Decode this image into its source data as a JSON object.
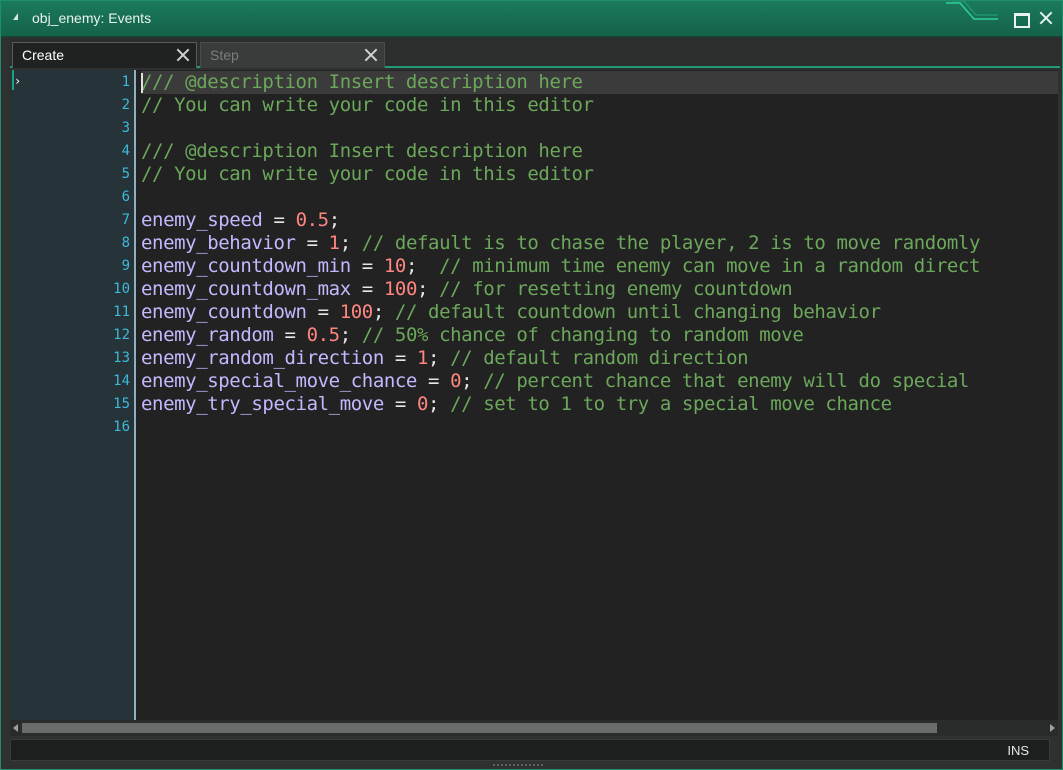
{
  "window": {
    "title": "obj_enemy: Events",
    "accent_color": "#1d8f6d"
  },
  "tabs": [
    {
      "label": "Create",
      "active": true
    },
    {
      "label": "Step",
      "active": false
    }
  ],
  "editor": {
    "current_line": 1,
    "line_numbers": [
      "1",
      "2",
      "3",
      "4",
      "5",
      "6",
      "7",
      "8",
      "9",
      "10",
      "11",
      "12",
      "13",
      "14",
      "15",
      "16"
    ],
    "lines": [
      [
        {
          "t": "comment",
          "v": "/// @description Insert description here"
        }
      ],
      [
        {
          "t": "comment",
          "v": "// You can write your code in this editor"
        }
      ],
      [],
      [
        {
          "t": "comment",
          "v": "/// @description Insert description here"
        }
      ],
      [
        {
          "t": "comment",
          "v": "// You can write your code in this editor"
        }
      ],
      [],
      [
        {
          "t": "var",
          "v": "enemy_speed"
        },
        {
          "t": "op",
          "v": " = "
        },
        {
          "t": "num",
          "v": "0.5"
        },
        {
          "t": "op",
          "v": ";"
        }
      ],
      [
        {
          "t": "var",
          "v": "enemy_behavior"
        },
        {
          "t": "op",
          "v": " = "
        },
        {
          "t": "num",
          "v": "1"
        },
        {
          "t": "op",
          "v": "; "
        },
        {
          "t": "comment",
          "v": "// default is to chase the player, 2 is to move randomly"
        }
      ],
      [
        {
          "t": "var",
          "v": "enemy_countdown_min"
        },
        {
          "t": "op",
          "v": " = "
        },
        {
          "t": "num",
          "v": "10"
        },
        {
          "t": "op",
          "v": ";  "
        },
        {
          "t": "comment",
          "v": "// minimum time enemy can move in a random direct"
        }
      ],
      [
        {
          "t": "var",
          "v": "enemy_countdown_max"
        },
        {
          "t": "op",
          "v": " = "
        },
        {
          "t": "num",
          "v": "100"
        },
        {
          "t": "op",
          "v": "; "
        },
        {
          "t": "comment",
          "v": "// for resetting enemy countdown"
        }
      ],
      [
        {
          "t": "var",
          "v": "enemy_countdown"
        },
        {
          "t": "op",
          "v": " = "
        },
        {
          "t": "num",
          "v": "100"
        },
        {
          "t": "op",
          "v": "; "
        },
        {
          "t": "comment",
          "v": "// default countdown until changing behavior"
        }
      ],
      [
        {
          "t": "var",
          "v": "enemy_random"
        },
        {
          "t": "op",
          "v": " = "
        },
        {
          "t": "num",
          "v": "0.5"
        },
        {
          "t": "op",
          "v": "; "
        },
        {
          "t": "comment",
          "v": "// 50% chance of changing to random move"
        }
      ],
      [
        {
          "t": "var",
          "v": "enemy_random_direction"
        },
        {
          "t": "op",
          "v": " = "
        },
        {
          "t": "num",
          "v": "1"
        },
        {
          "t": "op",
          "v": "; "
        },
        {
          "t": "comment",
          "v": "// default random direction"
        }
      ],
      [
        {
          "t": "var",
          "v": "enemy_special_move_chance"
        },
        {
          "t": "op",
          "v": " = "
        },
        {
          "t": "num",
          "v": "0"
        },
        {
          "t": "op",
          "v": "; "
        },
        {
          "t": "comment",
          "v": "// percent chance that enemy will do special"
        }
      ],
      [
        {
          "t": "var",
          "v": "enemy_try_special_move"
        },
        {
          "t": "op",
          "v": " = "
        },
        {
          "t": "num",
          "v": "0"
        },
        {
          "t": "op",
          "v": "; "
        },
        {
          "t": "comment",
          "v": "// set to 1 to try a special move chance"
        }
      ],
      []
    ]
  },
  "statusbar": {
    "mode": "INS"
  },
  "icons": {
    "collapse": "collapse-triangle-icon",
    "maximize": "maximize-icon",
    "close": "close-icon",
    "fold": "fold-arrow-icon"
  }
}
